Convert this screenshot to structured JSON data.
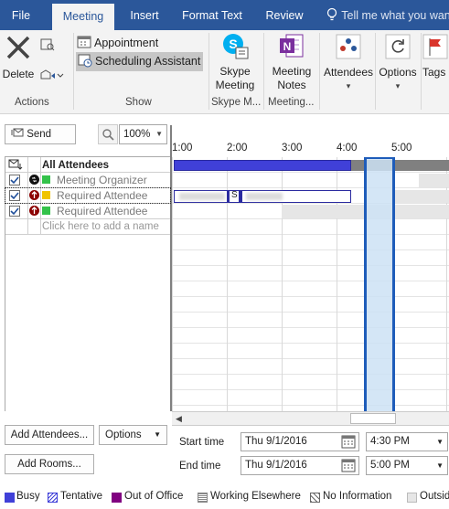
{
  "tabs": [
    {
      "label": "File"
    },
    {
      "label": "Meeting"
    },
    {
      "label": "Insert"
    },
    {
      "label": "Format Text"
    },
    {
      "label": "Review"
    }
  ],
  "tell_me": "Tell me what you want to do",
  "ribbon": {
    "delete": "Delete",
    "actions": "Actions",
    "appointment": "Appointment",
    "scheduling_assistant": "Scheduling Assistant",
    "show": "Show",
    "skype_line1": "Skype",
    "skype_line2": "Meeting",
    "skype_group": "Skype M...",
    "meeting_line1": "Meeting",
    "meeting_line2": "Notes",
    "meeting_group": "Meeting...",
    "attendees": "Attendees",
    "options": "Options",
    "tags": "Tags"
  },
  "toolbar": {
    "send": "Send",
    "zoom": "100%"
  },
  "times": [
    "1:00",
    "2:00",
    "3:00",
    "4:00",
    "5:00"
  ],
  "attendees": {
    "header": "All Attendees",
    "rows": [
      {
        "name": "Meeting Organizer"
      },
      {
        "name": "Required Attendee"
      },
      {
        "name": "Required Attendee"
      }
    ],
    "add_placeholder": "Click here to add a name"
  },
  "busy_label": "S",
  "bottom": {
    "add_attendees": "Add Attendees...",
    "options": "Options",
    "add_rooms": "Add Rooms...",
    "start_label": "Start time",
    "start_date": "Thu 9/1/2016",
    "start_time": "4:30 PM",
    "end_label": "End time",
    "end_date": "Thu 9/1/2016",
    "end_time": "5:00 PM"
  },
  "legend": [
    "Busy",
    "Tentative",
    "Out of Office",
    "Working Elsewhere",
    "No Information",
    "Outside"
  ],
  "colors": {
    "accent": "#2b579a",
    "busy": "#4040d8",
    "meeting": "#1e5cba",
    "selection": "#cde2f4",
    "out_of_office": "#800080"
  }
}
